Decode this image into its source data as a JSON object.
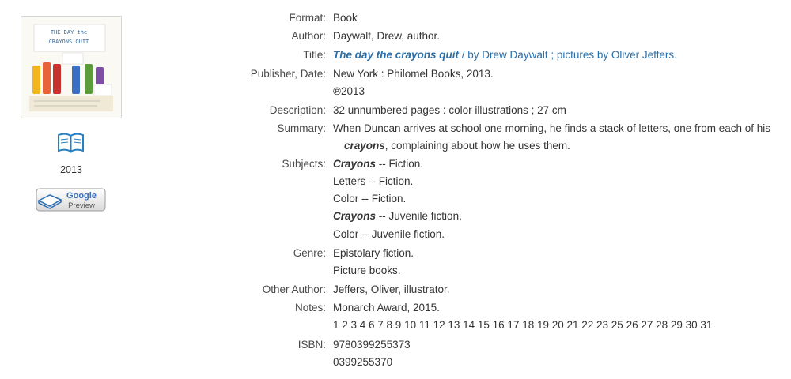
{
  "year": "2013",
  "google_preview": {
    "line1": "Google",
    "line2": "Preview"
  },
  "cover_text": {
    "title1": "THE DAY the",
    "title2": "CRAYONS QUIT"
  },
  "labels": {
    "format": "Format:",
    "author": "Author:",
    "title": "Title:",
    "publisher": "Publisher, Date:",
    "description": "Description:",
    "summary": "Summary:",
    "subjects": "Subjects:",
    "genre": "Genre:",
    "other_author": "Other Author:",
    "notes": "Notes:",
    "isbn": "ISBN:"
  },
  "format": "Book",
  "author": "Daywalt, Drew, author.",
  "title": {
    "main": "The day the crayons quit",
    "rest": " / by Drew Daywalt ; pictures by Oliver Jeffers."
  },
  "publisher": [
    "New York : Philomel Books, 2013.",
    "℗2013"
  ],
  "description": "32 unnumbered pages : color illustrations ; 27 cm",
  "summary": {
    "line1": "When Duncan arrives at school one morning, he finds a stack of letters, one from each of his",
    "em": "crayons",
    "line2_rest": ", complaining about how he uses them."
  },
  "subjects": [
    {
      "em": "Crayons",
      "rest": " -- Fiction."
    },
    {
      "em": "",
      "rest": "Letters -- Fiction."
    },
    {
      "em": "",
      "rest": "Color -- Fiction."
    },
    {
      "em": "Crayons",
      "rest": " -- Juvenile fiction."
    },
    {
      "em": "",
      "rest": "Color -- Juvenile fiction."
    }
  ],
  "genre": [
    "Epistolary fiction.",
    "Picture books."
  ],
  "other_author": "Jeffers, Oliver, illustrator.",
  "notes": [
    "Monarch Award, 2015.",
    "1 2 3 4 6 7 8 9 10 11 12 13 14 15 16 17 18 19 20 21 22 23 25 26 27 28 29 30 31"
  ],
  "isbn": [
    "9780399255373",
    "0399255370"
  ]
}
